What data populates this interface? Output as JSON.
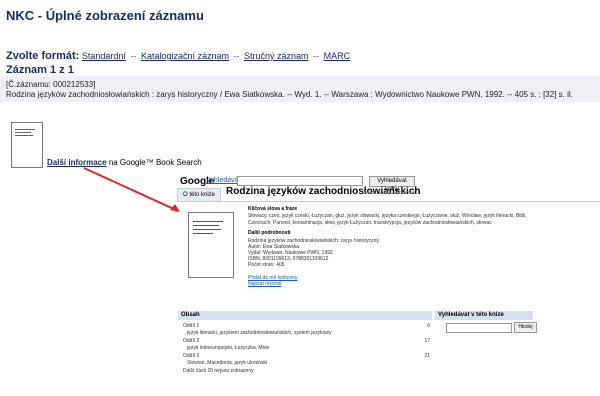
{
  "header": {
    "title": "NKC - Úplné zobrazení záznamu"
  },
  "format": {
    "label": "Zvolte formát:",
    "options": [
      "Standardní",
      "Katalogizační záznam",
      "Stručný záznam",
      "MARC"
    ],
    "separator": "--"
  },
  "record": {
    "count": "Záznam 1 z 1",
    "id_line": "[Č.záznamu: 000212533]",
    "citation": "Rodzina języków zachodniosłowiańskich : zarys historyczny / Ewa Siatkowska. -- Wyd. 1. -- Warszawa : Wydownictwo Naukowe PWN, 1992. -- 405 s. : [32] s. il."
  },
  "google_link": {
    "link_text": "Další informace",
    "suffix": "na Google™ Book Search"
  },
  "google_panel": {
    "logo": "Google",
    "search_label": "Vyhledávání knih",
    "search_button": "Vyhledávat knihy",
    "tab_label": "O této knize",
    "book_title": "Rodzina języków zachodniosłowiańskich",
    "author_line": "Autor: Ewa Siatkowska",
    "keywords_heading": "Klíčová slova a fráze",
    "keywords_line1": "Słowacy, czes, język czeski, Łużyczan, głuż, język słowacki, języka czeskiego, Łużyczanie, służ, Wrocław, język literacki, Bibli,",
    "keywords_line2": "Czechach, Panonii, kontaminacja, słow, język Łużyczan, transkrypcja, języków zachodniosłowiańskich, słowac",
    "details_heading": "Další podrobnosti",
    "details": [
      "Rodzina języków zachodniosłowiańskich: zarys historyczny",
      "Autor: Ewa Siatkowska",
      "Vydal: Wydawn. Naukowe PWN, 1992",
      "ISBN: 8301109613, 9788301109612",
      "Počet stran: 405"
    ],
    "library_link": "Přidat do mé knihovny",
    "review_link": "Napsat recenzi",
    "toc_heading": "Obsah",
    "toc_items": [
      {
        "title": "Oddíl 1",
        "page": "6"
      },
      {
        "title": "język literacki, językiem zachodniosłowiańskich, system językowy",
        "page": ""
      },
      {
        "title": "Oddíl 2",
        "page": "17"
      },
      {
        "title": "język indoeuropejski, Łużyczka, Mnie",
        "page": ""
      },
      {
        "title": "Oddíl 3",
        "page": "21"
      },
      {
        "title": "Słowian, Macedonia, język ukraiński",
        "page": ""
      },
      {
        "title": "Další části 20 nejsou zobrazeny",
        "page": ""
      }
    ],
    "search_in_heading": "Vyhledávat v této knize",
    "search_in_button": "Hledej"
  },
  "colors": {
    "title_blue": "#1a2a6c",
    "link_blue": "#1a5fbd",
    "band": "#d4e0f4",
    "arrow_red": "#e3262a"
  }
}
